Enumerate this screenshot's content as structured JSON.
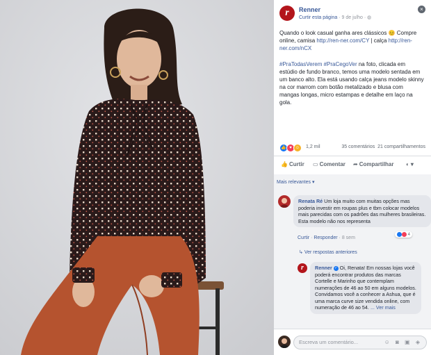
{
  "post": {
    "page_name": "Renner",
    "logo_letter": "r",
    "like_page": "Curtir esta página",
    "separator": "·",
    "date": "9 de julho",
    "privacy_icon": "globe-icon",
    "close_icon": "close-icon",
    "text_p1": "Quando o look casual ganha ares clássicos 😊",
    "text_p1_b": "Compre online, camisa",
    "link1": "http://ren-ner.com/CY",
    "text_p1_c": "| calça",
    "link2": "http://ren-ner.com/nCX",
    "hashtags": "#PraTodasVerem #PraCegoVer",
    "text_p2": "na foto, clicada em estúdio de fundo branco, temos uma modelo sentada em um banco alto. Ela está usando calça jeans modelo skinny na cor marrom com botão metalizado e blusa com mangas longas, micro estampas e detalhe em laço na gola."
  },
  "reactions": {
    "count": "1,2 mil",
    "comments": "35 comentários",
    "shares": "21 compartilhamentos"
  },
  "actions": {
    "like": "Curtir",
    "comment": "Comentar",
    "share": "Compartilhar",
    "caret": "▾"
  },
  "comments": {
    "sort_label": "Mais relevantes ▾",
    "c1": {
      "author": "Renata Ré",
      "text": "Um loja muito com muitas opções mas poderia investir em roupas plus e tbm colocar modelos mais parecidas com os padrões das mulheres brasileiras. Esta modelo não nos representa",
      "like": "Curtir",
      "reply": "Responder",
      "time": "8 sem",
      "reaction_count": "4"
    },
    "previous_replies": "Ver respostas anteriores",
    "c2": {
      "author": "Renner",
      "text": "Oi, Renata! Em nossas lojas você poderá encontrar produtos das marcas Cortelle e Marinho que contemplam numerações de 46 ao 50 em alguns modelos. Convidamos você a conhecer a Ashua, que é uma marca curve size vendida online, com numeração de 46 ao 54.",
      "more": "... Ver mais"
    }
  },
  "compose": {
    "placeholder": "Escreva um comentário...",
    "icons": "☺ ◙ ▣ ◈"
  },
  "colors": {
    "brand_red": "#b3151b",
    "link_blue": "#385898"
  }
}
